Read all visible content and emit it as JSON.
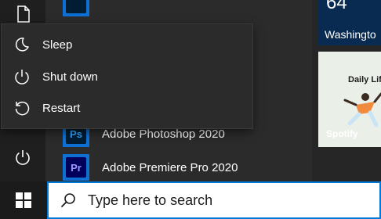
{
  "power_menu": {
    "items": [
      {
        "label": "Sleep",
        "icon": "moon-icon"
      },
      {
        "label": "Shut down",
        "icon": "power-icon"
      },
      {
        "label": "Restart",
        "icon": "restart-icon"
      }
    ]
  },
  "apps": [
    {
      "label": "Adobe Photoshop 2020",
      "tile_text": "Ps"
    },
    {
      "label": "Adobe Premiere Pro 2020",
      "tile_text": "Pr"
    }
  ],
  "tiles": {
    "weather": {
      "temp": "64",
      "city": "Washingto"
    },
    "spotify": {
      "headline": "Daily Lif",
      "brand": "Spotify"
    }
  },
  "search": {
    "placeholder": "Type here to search"
  },
  "colors": {
    "accent": "#0078d7",
    "photoshop": "#31a8ff",
    "premiere": "#9999ff"
  }
}
